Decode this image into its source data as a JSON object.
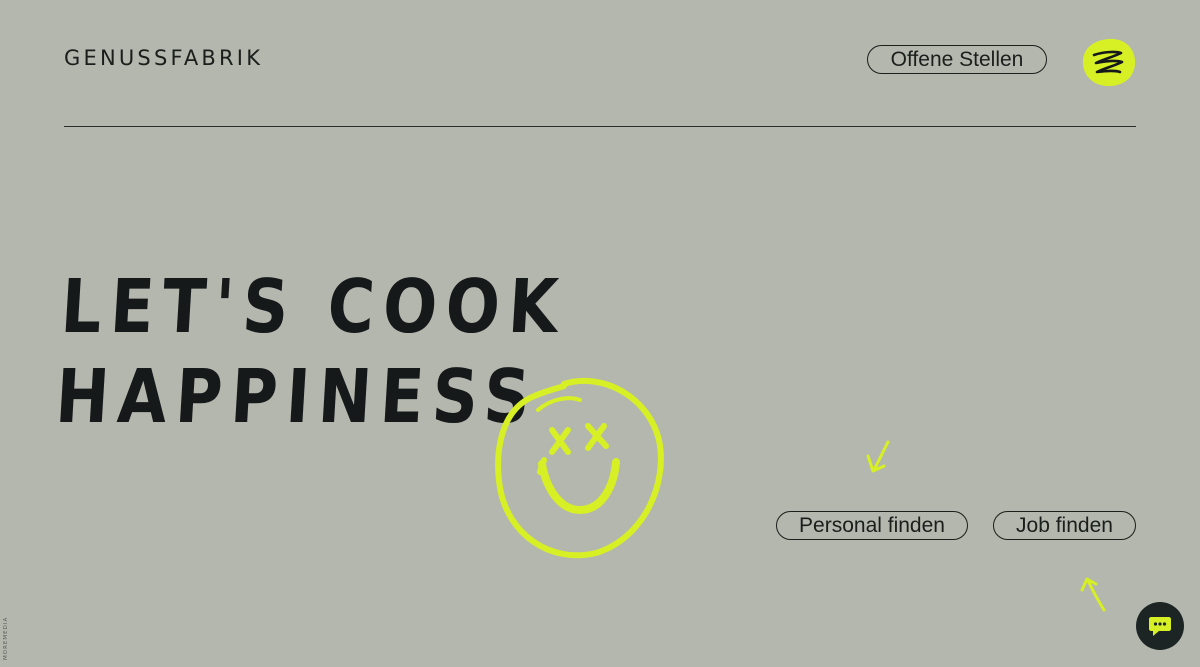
{
  "header": {
    "logo": "GENUSSFABRIK",
    "jobs_link": "Offene Stellen",
    "menu_icon": "scribble-menu-icon"
  },
  "hero": {
    "line1": "LET'S COOK",
    "line2": "HAPPINESS"
  },
  "actions": {
    "personal": "Personal finden",
    "job": "Job finden"
  },
  "credit": "MOREMEDIA",
  "chat_icon": "chat-bubble-icon",
  "colors": {
    "background": "#b4b7ae",
    "accent": "#d7f025",
    "ink": "#1a1f1c",
    "chat_button": "#1c2524"
  }
}
